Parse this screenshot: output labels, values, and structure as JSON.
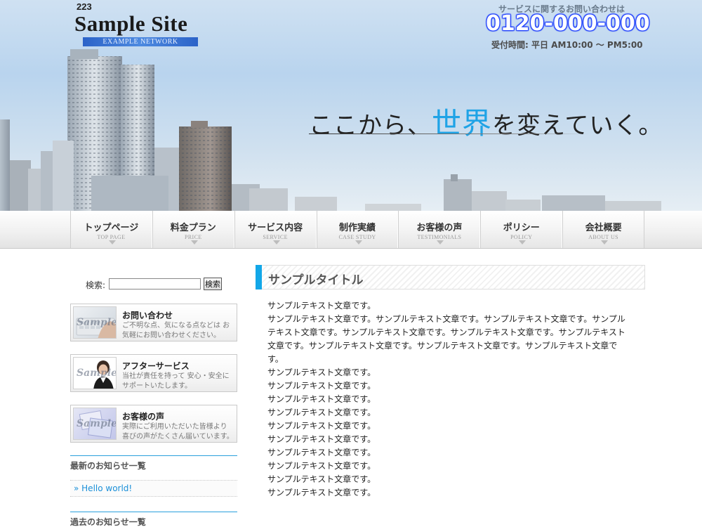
{
  "header": {
    "site_number": "223",
    "site_title": "Sample Site",
    "site_tagline": "EXAMPLE NETWORK",
    "contact_lead": "サービスに関するお問い合わせは",
    "phone": "0120-000-000",
    "hours": "受付時間: 平日 AM10:00 〜 PM5:00",
    "hero_copy_before": "ここから、",
    "hero_copy_accent": "世界",
    "hero_copy_after": "を変えていく。",
    "accent_color": "#1fa3e6"
  },
  "nav": {
    "items": [
      {
        "jp": "トップページ",
        "en": "TOP PAGE"
      },
      {
        "jp": "料金プラン",
        "en": "PRICE"
      },
      {
        "jp": "サービス内容",
        "en": "SERVICE"
      },
      {
        "jp": "制作実績",
        "en": "CASE STUDY"
      },
      {
        "jp": "お客様の声",
        "en": "TESTIMONIALS"
      },
      {
        "jp": "ポリシー",
        "en": "POLICY"
      },
      {
        "jp": "会社概要",
        "en": "ABOUT US"
      }
    ]
  },
  "sidebar": {
    "search_label": "検索:",
    "search_value": "",
    "search_button": "検索",
    "banners": [
      {
        "title": "お問い合わせ",
        "desc": "ご不明な点、気になる点などは お気軽にお問い合わせください。",
        "thumb": "Sample"
      },
      {
        "title": "アフターサービス",
        "desc": "当社が責任を持って 安心・安全にサポートいたします。",
        "thumb": "Sample"
      },
      {
        "title": "お客様の声",
        "desc": "実際にご利用いただいた皆様より 喜びの声がたくさん届いています。",
        "thumb": "Sample"
      }
    ],
    "news_heading": "最新のお知らせ一覧",
    "news_link": "» Hello world!",
    "past_heading": "過去のお知らせ一覧",
    "heading_color": "#2aa0dc"
  },
  "main": {
    "title": "サンプルタイトル",
    "title_mark_color": "#12a7e8",
    "lead": "サンプルテキスト文章です。",
    "paragraph": "サンプルテキスト文章です。サンプルテキスト文章です。サンプルテキスト文章です。サンプルテキスト文章です。サンプルテキスト文章です。サンプルテキスト文章です。サンプルテキスト文章です。サンプルテキスト文章です。サンプルテキスト文章です。サンプルテキスト文章です。",
    "lines": [
      "サンプルテキスト文章です。",
      "サンプルテキスト文章です。",
      "サンプルテキスト文章です。",
      "サンプルテキスト文章です。",
      "サンプルテキスト文章です。",
      "サンプルテキスト文章です。",
      "サンプルテキスト文章です。",
      "サンプルテキスト文章です。",
      "サンプルテキスト文章です。",
      "サンプルテキスト文章です。"
    ]
  }
}
